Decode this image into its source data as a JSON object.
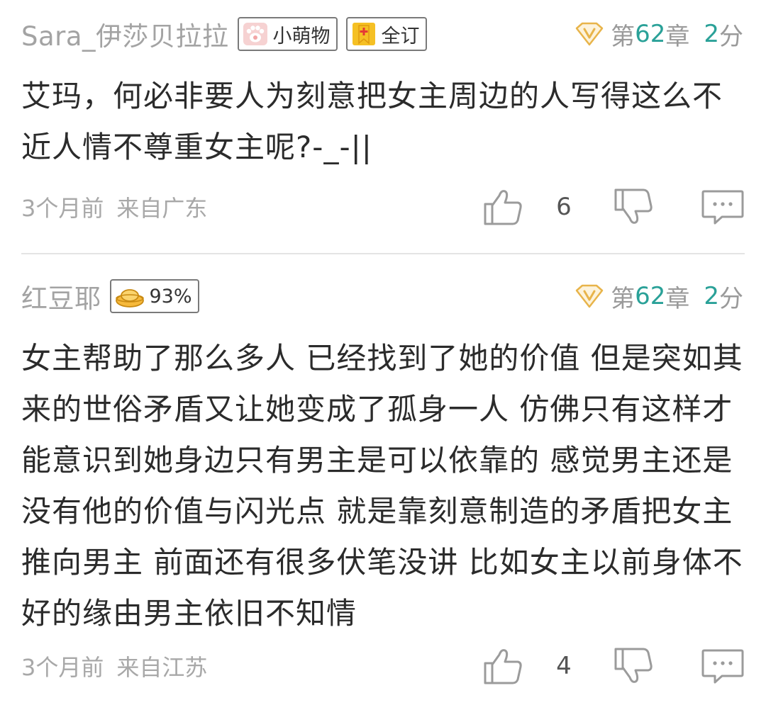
{
  "comments": [
    {
      "username": "Sara_伊莎贝拉拉",
      "badges": [
        {
          "label": "小萌物",
          "icon": "paw-icon"
        },
        {
          "label": "全订",
          "icon": "bookmark-plus-icon"
        }
      ],
      "chapter_prefix": "第",
      "chapter_num": "62",
      "chapter_suffix": "章",
      "score_num": "2",
      "score_unit": "分",
      "text": "艾玛，何必非要人为刻意把女主周边的人写得这么不近人情不尊重女主呢?-_-||",
      "time": "3个月前",
      "location": "来自广东",
      "likes": "6"
    },
    {
      "username": "红豆耶",
      "badges": [
        {
          "label": "93%",
          "icon": "gold-ingot-icon"
        }
      ],
      "chapter_prefix": "第",
      "chapter_num": "62",
      "chapter_suffix": "章",
      "score_num": "2",
      "score_unit": "分",
      "text": "女主帮助了那么多人 已经找到了她的价值 但是突如其来的世俗矛盾又让她变成了孤身一人 仿佛只有这样才能意识到她身边只有男主是可以依靠的 感觉男主还是没有他的价值与闪光点 就是靠刻意制造的矛盾把女主推向男主 前面还有很多伏笔没讲 比如女主以前身体不好的缘由男主依旧不知情",
      "time": "3个月前",
      "location": "来自江苏",
      "likes": "4"
    }
  ],
  "colors": {
    "accent": "#2aa198",
    "meta": "#a8a8a8",
    "vip_gold": "#e8b44a"
  }
}
